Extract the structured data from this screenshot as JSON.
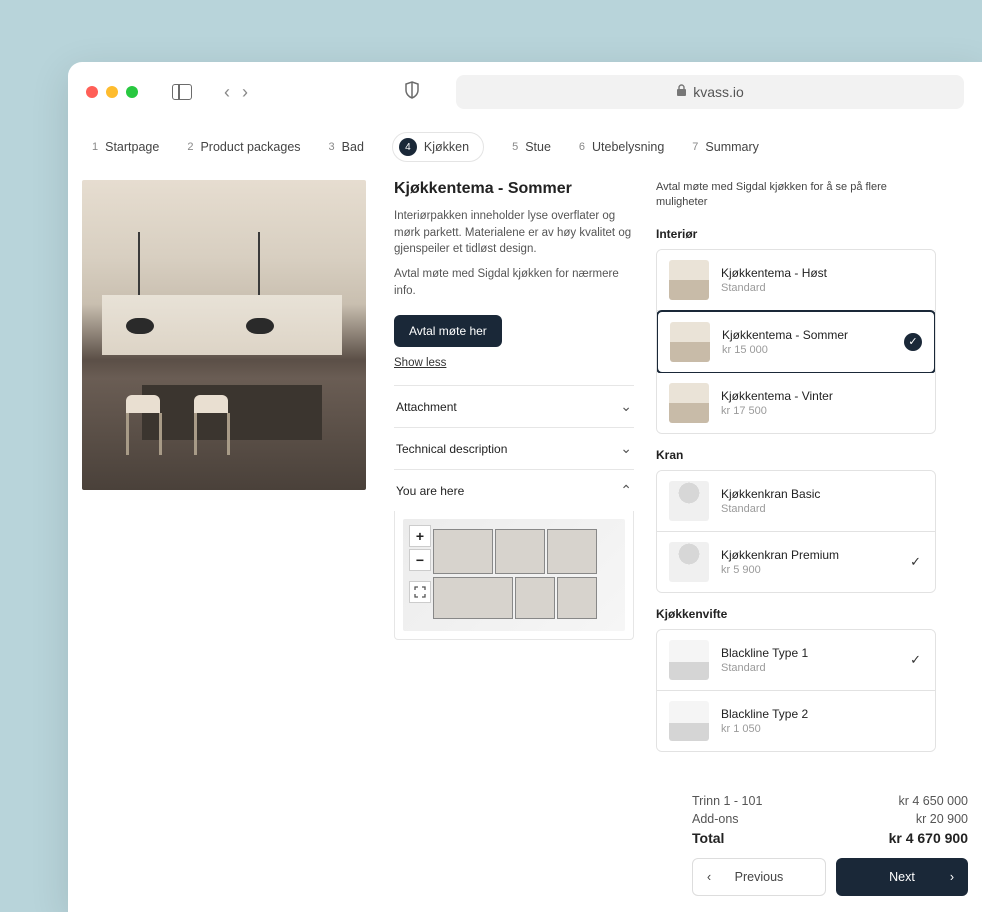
{
  "browser": {
    "url_host": "kvass.io"
  },
  "steps": [
    {
      "num": "1",
      "label": "Startpage"
    },
    {
      "num": "2",
      "label": "Product packages"
    },
    {
      "num": "3",
      "label": "Bad"
    },
    {
      "num": "4",
      "label": "Kjøkken"
    },
    {
      "num": "5",
      "label": "Stue"
    },
    {
      "num": "6",
      "label": "Utebelysning"
    },
    {
      "num": "7",
      "label": "Summary"
    }
  ],
  "detail": {
    "title": "Kjøkkentema - Sommer",
    "desc1": "Interiørpakken inneholder lyse overflater og mørk parkett. Materialene er av høy kvalitet og gjenspeiler et tidløst design.",
    "desc2": "Avtal møte med Sigdal kjøkken for nærmere info.",
    "cta": "Avtal møte her",
    "show_less": "Show less",
    "accordion": {
      "attachment": "Attachment",
      "technical": "Technical description",
      "you_are_here": "You are here"
    }
  },
  "sidebar": {
    "intro": "Avtal møte med Sigdal kjøkken for å se på flere muligheter",
    "sections": {
      "interior": {
        "title": "Interiør",
        "options": [
          {
            "name": "Kjøkkentema - Høst",
            "sub": "Standard"
          },
          {
            "name": "Kjøkkentema - Sommer",
            "sub": "kr 15 000"
          },
          {
            "name": "Kjøkkentema - Vinter",
            "sub": "kr 17 500"
          }
        ]
      },
      "faucet": {
        "title": "Kran",
        "options": [
          {
            "name": "Kjøkkenkran Basic",
            "sub": "Standard"
          },
          {
            "name": "Kjøkkenkran Premium",
            "sub": "kr 5 900"
          }
        ]
      },
      "hood": {
        "title": "Kjøkkenvifte",
        "options": [
          {
            "name": "Blackline Type 1",
            "sub": "Standard"
          },
          {
            "name": "Blackline Type 2",
            "sub": "kr 1 050"
          }
        ]
      }
    }
  },
  "summary": {
    "unit_label": "Trinn 1 - 101",
    "unit_price": "kr 4 650 000",
    "addons_label": "Add-ons",
    "addons_price": "kr 20 900",
    "total_label": "Total",
    "total_price": "kr 4 670 900",
    "prev": "Previous",
    "next": "Next"
  }
}
